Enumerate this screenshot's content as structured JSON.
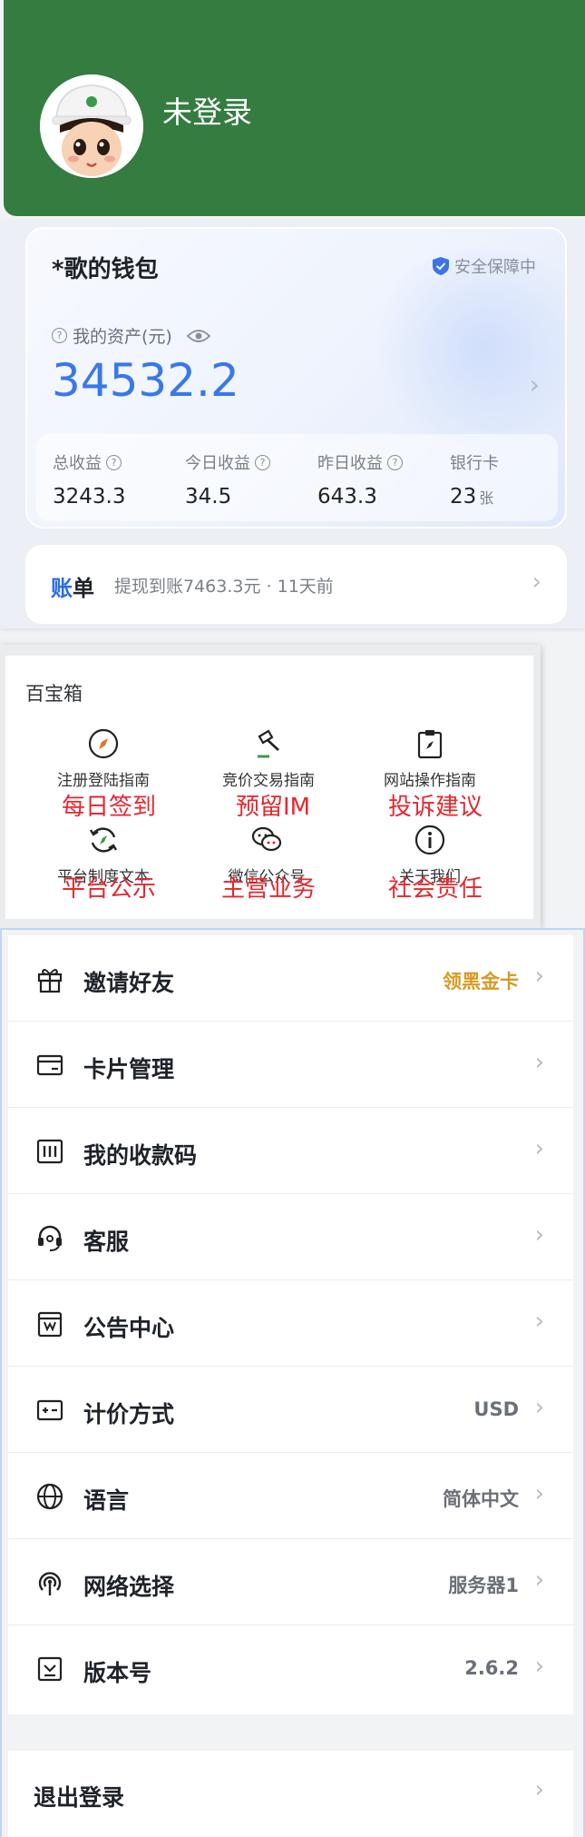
{
  "header": {
    "login_status": "未登录",
    "avatar_icon": "cartoon-worker-avatar-icon",
    "background_color": "#347c3f"
  },
  "wallet": {
    "title": "*歌的钱包",
    "security_badge": "安全保障中",
    "asset_label": "我的资产(元)",
    "asset_value": "34532.2",
    "accent_color": "#3a78e8",
    "stats": [
      {
        "label": "总收益",
        "value": "3243.3",
        "unit": ""
      },
      {
        "label": "今日收益",
        "value": "34.5",
        "unit": ""
      },
      {
        "label": "昨日收益",
        "value": "643.3",
        "unit": ""
      },
      {
        "label": "银行卡",
        "value": "23",
        "unit": "张"
      }
    ]
  },
  "bill": {
    "tag_part1": "账",
    "tag_part2": "单",
    "text": "提现到账7463.3元 · 11天前"
  },
  "toolbox": {
    "title": "百宝箱",
    "items": [
      {
        "name": "注册登陆指南",
        "overlay": "每日签到",
        "icon": "compass-icon"
      },
      {
        "name": "竞价交易指南",
        "overlay": "预留IM",
        "icon": "gavel-icon"
      },
      {
        "name": "网站操作指南",
        "overlay": "投诉建议",
        "icon": "clipboard-compass-icon"
      },
      {
        "name": "平台制度文本",
        "overlay": "平台公示",
        "icon": "refresh-compass-icon"
      },
      {
        "name": "微信公众号",
        "overlay": "主营业务",
        "icon": "wechat-icon"
      },
      {
        "name": "关于我们",
        "overlay": "社会责任",
        "icon": "info-icon"
      }
    ],
    "overlay_color": "#e8262e"
  },
  "menu": {
    "items": [
      {
        "label": "邀请好友",
        "value": "领黑金卡",
        "icon": "gift-icon"
      },
      {
        "label": "卡片管理",
        "value": "",
        "icon": "card-icon"
      },
      {
        "label": "我的收款码",
        "value": "",
        "icon": "barcode-icon"
      },
      {
        "label": "客服",
        "value": "",
        "icon": "headset-icon"
      },
      {
        "label": "公告中心",
        "value": "",
        "icon": "notice-icon"
      },
      {
        "label": "计价方式",
        "value": "USD",
        "icon": "pricing-icon"
      },
      {
        "label": "语言",
        "value": "简体中文",
        "icon": "globe-icon"
      },
      {
        "label": "网络选择",
        "value": "服务器1",
        "icon": "signal-icon"
      },
      {
        "label": "版本号",
        "value": "2.6.2",
        "icon": "download-icon"
      }
    ],
    "highlight_color": "#d69a24"
  },
  "logout": {
    "label": "退出登录"
  }
}
